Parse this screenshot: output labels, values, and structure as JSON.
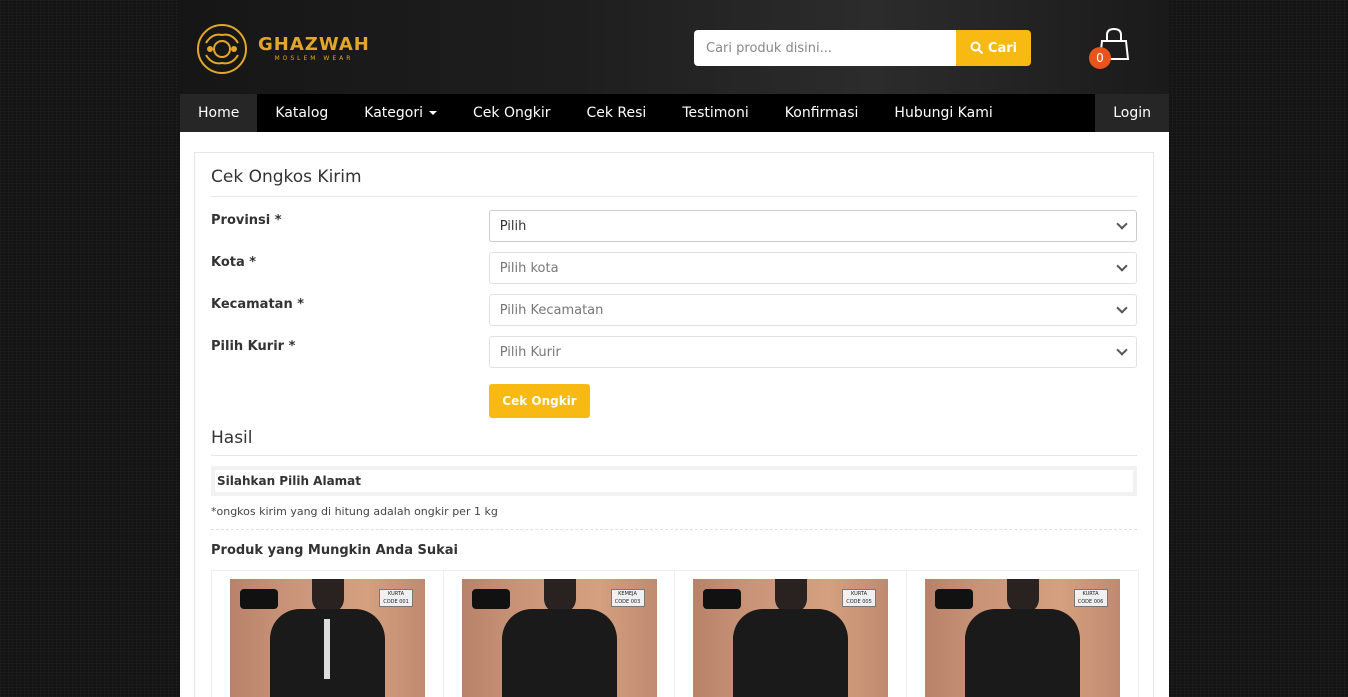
{
  "brand": {
    "name": "GHAZWAH",
    "tagline": "MOSLEM WEAR",
    "color": "#e2a72a"
  },
  "search": {
    "placeholder": "Cari produk disini...",
    "button_label": "Cari"
  },
  "cart": {
    "count": "0"
  },
  "nav": {
    "items": [
      {
        "label": "Home",
        "active": true
      },
      {
        "label": "Katalog"
      },
      {
        "label": "Kategori",
        "dropdown": true
      },
      {
        "label": "Cek Ongkir"
      },
      {
        "label": "Cek Resi"
      },
      {
        "label": "Testimoni"
      },
      {
        "label": "Konfirmasi"
      },
      {
        "label": "Hubungi Kami"
      }
    ],
    "login": "Login"
  },
  "form": {
    "title": "Cek Ongkos Kirim",
    "fields": [
      {
        "label": "Provinsi *",
        "value": "Pilih"
      },
      {
        "label": "Kota *",
        "value": "Pilih kota"
      },
      {
        "label": "Kecamatan *",
        "value": "Pilih Kecamatan"
      },
      {
        "label": "Pilih Kurir *",
        "value": "Pilih Kurir"
      }
    ],
    "submit_label": "Cek Ongkir"
  },
  "result": {
    "title": "Hasil",
    "message": "Silahkan Pilih Alamat",
    "note": "*ongkos kirim yang di hitung adalah ongkir per 1 kg"
  },
  "products": {
    "title": "Produk yang Mungkin Anda Sukai",
    "items": [
      {
        "tag": "KURTA CODE 001"
      },
      {
        "tag": "KEMEJA CODE 003"
      },
      {
        "tag": "KURTA CODE 005"
      },
      {
        "tag": "KURTA CODE 006"
      }
    ]
  },
  "colors": {
    "accent": "#f8b912",
    "badge": "#e8551b",
    "nav_bg": "#000000"
  }
}
